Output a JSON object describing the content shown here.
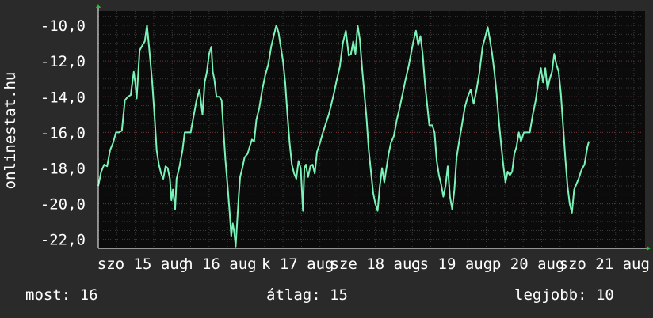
{
  "colors": {
    "background": "#2a2a2a",
    "plot_background": "#0b0b0b",
    "line": "#7af2b8",
    "text": "#ffffff",
    "grid_major": "#6e2e2e",
    "grid_minor": "#3a3a3a",
    "axis_arrow": "#22cc22"
  },
  "side_label": "onlinestat.hu",
  "stats": {
    "now": "most: 16",
    "avg": "átlag: 15",
    "best": "legjobb: 10"
  },
  "chart_data": {
    "type": "line",
    "title": "",
    "xlabel": "",
    "ylabel": "",
    "ylim": [
      -22.5,
      -9.2
    ],
    "xlim": [
      0,
      7.4
    ],
    "yticks": [
      "-10,0",
      "-12,0",
      "-14,0",
      "-16,0",
      "-18,0",
      "-20,0",
      "-22,0"
    ],
    "ytick_values": [
      -10,
      -12,
      -14,
      -16,
      -18,
      -20,
      -22
    ],
    "xticks": [
      {
        "label": "szo 15 aug",
        "x": 0.6
      },
      {
        "label": "h 16 aug",
        "x": 1.65
      },
      {
        "label": "k 17 aug",
        "x": 2.7
      },
      {
        "label": "sze 18 aug",
        "x": 3.75
      },
      {
        "label": "cs 19 aug",
        "x": 4.78
      },
      {
        "label": "p 20 aug",
        "x": 5.82
      },
      {
        "label": "szo 21 aug",
        "x": 6.85
      }
    ],
    "grid": true,
    "series": [
      {
        "color": "#7af2b8",
        "points": [
          [
            0.0,
            -19.0
          ],
          [
            0.04,
            -18.2
          ],
          [
            0.08,
            -17.8
          ],
          [
            0.12,
            -17.9
          ],
          [
            0.16,
            -17.0
          ],
          [
            0.2,
            -16.6
          ],
          [
            0.24,
            -16.0
          ],
          [
            0.28,
            -16.0
          ],
          [
            0.32,
            -15.9
          ],
          [
            0.36,
            -14.2
          ],
          [
            0.4,
            -14.0
          ],
          [
            0.44,
            -13.9
          ],
          [
            0.48,
            -12.6
          ],
          [
            0.5,
            -13.2
          ],
          [
            0.52,
            -14.1
          ],
          [
            0.56,
            -11.4
          ],
          [
            0.6,
            -11.1
          ],
          [
            0.63,
            -10.9
          ],
          [
            0.66,
            -10.0
          ],
          [
            0.69,
            -11.3
          ],
          [
            0.73,
            -13.2
          ],
          [
            0.76,
            -15.0
          ],
          [
            0.79,
            -17.0
          ],
          [
            0.82,
            -17.8
          ],
          [
            0.85,
            -18.3
          ],
          [
            0.88,
            -18.6
          ],
          [
            0.91,
            -17.9
          ],
          [
            0.94,
            -18.0
          ],
          [
            0.97,
            -18.6
          ],
          [
            0.99,
            -19.8
          ],
          [
            1.01,
            -19.2
          ],
          [
            1.04,
            -20.3
          ],
          [
            1.06,
            -18.6
          ],
          [
            1.1,
            -17.9
          ],
          [
            1.14,
            -17.0
          ],
          [
            1.17,
            -16.0
          ],
          [
            1.21,
            -16.0
          ],
          [
            1.25,
            -16.0
          ],
          [
            1.29,
            -15.1
          ],
          [
            1.33,
            -14.2
          ],
          [
            1.37,
            -13.6
          ],
          [
            1.41,
            -15.0
          ],
          [
            1.44,
            -13.2
          ],
          [
            1.47,
            -12.6
          ],
          [
            1.5,
            -11.6
          ],
          [
            1.53,
            -11.2
          ],
          [
            1.55,
            -12.6
          ],
          [
            1.57,
            -13.0
          ],
          [
            1.6,
            -14.0
          ],
          [
            1.64,
            -14.0
          ],
          [
            1.67,
            -14.2
          ],
          [
            1.69,
            -15.6
          ],
          [
            1.72,
            -17.5
          ],
          [
            1.75,
            -19.0
          ],
          [
            1.78,
            -20.6
          ],
          [
            1.8,
            -21.8
          ],
          [
            1.82,
            -21.1
          ],
          [
            1.84,
            -21.6
          ],
          [
            1.86,
            -22.4
          ],
          [
            1.88,
            -21.0
          ],
          [
            1.9,
            -19.6
          ],
          [
            1.92,
            -18.5
          ],
          [
            1.95,
            -18.0
          ],
          [
            1.98,
            -17.4
          ],
          [
            2.02,
            -17.2
          ],
          [
            2.05,
            -16.8
          ],
          [
            2.08,
            -16.4
          ],
          [
            2.11,
            -16.5
          ],
          [
            2.14,
            -15.3
          ],
          [
            2.18,
            -14.6
          ],
          [
            2.22,
            -13.6
          ],
          [
            2.26,
            -12.8
          ],
          [
            2.3,
            -12.2
          ],
          [
            2.34,
            -11.2
          ],
          [
            2.38,
            -10.5
          ],
          [
            2.41,
            -10.0
          ],
          [
            2.44,
            -10.4
          ],
          [
            2.47,
            -11.2
          ],
          [
            2.5,
            -12.0
          ],
          [
            2.53,
            -13.2
          ],
          [
            2.56,
            -15.0
          ],
          [
            2.59,
            -16.6
          ],
          [
            2.62,
            -17.8
          ],
          [
            2.65,
            -18.3
          ],
          [
            2.68,
            -18.6
          ],
          [
            2.71,
            -17.6
          ],
          [
            2.74,
            -18.0
          ],
          [
            2.77,
            -20.4
          ],
          [
            2.79,
            -18.0
          ],
          [
            2.81,
            -17.8
          ],
          [
            2.84,
            -18.5
          ],
          [
            2.87,
            -17.9
          ],
          [
            2.9,
            -17.8
          ],
          [
            2.93,
            -18.3
          ],
          [
            2.96,
            -17.1
          ],
          [
            3.0,
            -16.6
          ],
          [
            3.04,
            -16.0
          ],
          [
            3.08,
            -15.5
          ],
          [
            3.12,
            -15.0
          ],
          [
            3.15,
            -14.5
          ],
          [
            3.19,
            -13.8
          ],
          [
            3.23,
            -13.0
          ],
          [
            3.27,
            -12.3
          ],
          [
            3.31,
            -11.0
          ],
          [
            3.35,
            -10.3
          ],
          [
            3.39,
            -11.7
          ],
          [
            3.42,
            -11.6
          ],
          [
            3.45,
            -10.9
          ],
          [
            3.48,
            -11.6
          ],
          [
            3.51,
            -10.0
          ],
          [
            3.54,
            -10.8
          ],
          [
            3.57,
            -12.4
          ],
          [
            3.6,
            -13.8
          ],
          [
            3.63,
            -15.2
          ],
          [
            3.66,
            -17.0
          ],
          [
            3.69,
            -18.2
          ],
          [
            3.72,
            -19.4
          ],
          [
            3.75,
            -20.0
          ],
          [
            3.78,
            -20.4
          ],
          [
            3.81,
            -19.0
          ],
          [
            3.84,
            -18.0
          ],
          [
            3.87,
            -18.8
          ],
          [
            3.9,
            -18.0
          ],
          [
            3.93,
            -17.2
          ],
          [
            3.96,
            -16.6
          ],
          [
            4.0,
            -16.2
          ],
          [
            4.04,
            -15.3
          ],
          [
            4.08,
            -14.6
          ],
          [
            4.12,
            -13.8
          ],
          [
            4.16,
            -13.0
          ],
          [
            4.2,
            -12.3
          ],
          [
            4.24,
            -11.4
          ],
          [
            4.27,
            -10.8
          ],
          [
            4.3,
            -10.3
          ],
          [
            4.33,
            -11.1
          ],
          [
            4.36,
            -10.6
          ],
          [
            4.39,
            -11.6
          ],
          [
            4.42,
            -13.2
          ],
          [
            4.45,
            -14.4
          ],
          [
            4.48,
            -15.6
          ],
          [
            4.52,
            -15.6
          ],
          [
            4.55,
            -16.0
          ],
          [
            4.58,
            -17.6
          ],
          [
            4.61,
            -18.4
          ],
          [
            4.64,
            -18.9
          ],
          [
            4.67,
            -19.6
          ],
          [
            4.7,
            -19.0
          ],
          [
            4.73,
            -17.9
          ],
          [
            4.76,
            -19.6
          ],
          [
            4.79,
            -20.3
          ],
          [
            4.82,
            -19.2
          ],
          [
            4.85,
            -17.4
          ],
          [
            4.88,
            -16.6
          ],
          [
            4.92,
            -15.6
          ],
          [
            4.96,
            -14.6
          ],
          [
            5.0,
            -14.0
          ],
          [
            5.04,
            -13.6
          ],
          [
            5.08,
            -14.4
          ],
          [
            5.12,
            -13.6
          ],
          [
            5.16,
            -12.6
          ],
          [
            5.2,
            -11.2
          ],
          [
            5.24,
            -10.6
          ],
          [
            5.27,
            -10.1
          ],
          [
            5.3,
            -10.8
          ],
          [
            5.33,
            -11.6
          ],
          [
            5.36,
            -12.6
          ],
          [
            5.39,
            -13.8
          ],
          [
            5.42,
            -15.3
          ],
          [
            5.45,
            -16.6
          ],
          [
            5.48,
            -17.8
          ],
          [
            5.51,
            -18.8
          ],
          [
            5.54,
            -18.2
          ],
          [
            5.57,
            -18.4
          ],
          [
            5.6,
            -18.2
          ],
          [
            5.63,
            -17.2
          ],
          [
            5.66,
            -16.8
          ],
          [
            5.69,
            -16.0
          ],
          [
            5.72,
            -16.5
          ],
          [
            5.76,
            -16.0
          ],
          [
            5.8,
            -16.0
          ],
          [
            5.84,
            -16.0
          ],
          [
            5.88,
            -15.0
          ],
          [
            5.92,
            -14.2
          ],
          [
            5.96,
            -13.0
          ],
          [
            5.99,
            -12.4
          ],
          [
            6.02,
            -13.2
          ],
          [
            6.05,
            -12.4
          ],
          [
            6.08,
            -13.6
          ],
          [
            6.11,
            -13.0
          ],
          [
            6.14,
            -12.6
          ],
          [
            6.17,
            -11.6
          ],
          [
            6.2,
            -12.2
          ],
          [
            6.23,
            -12.6
          ],
          [
            6.26,
            -13.8
          ],
          [
            6.29,
            -15.6
          ],
          [
            6.32,
            -17.4
          ],
          [
            6.35,
            -19.0
          ],
          [
            6.38,
            -20.0
          ],
          [
            6.41,
            -20.5
          ],
          [
            6.44,
            -19.2
          ],
          [
            6.47,
            -18.9
          ],
          [
            6.5,
            -18.6
          ],
          [
            6.54,
            -18.1
          ],
          [
            6.58,
            -17.8
          ],
          [
            6.62,
            -16.8
          ],
          [
            6.64,
            -16.5
          ]
        ]
      }
    ]
  }
}
